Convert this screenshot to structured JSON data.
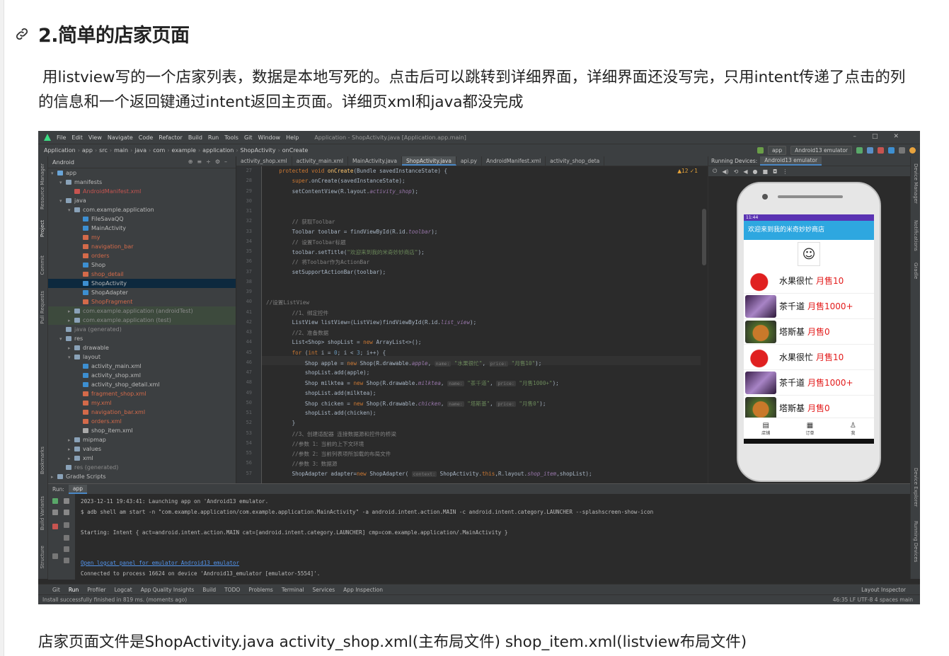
{
  "heading": "2.简单的店家页面",
  "paragraph": "用listview写的一个店家列表，数据是本地写死的。点击后可以跳转到详细界面，详细界面还没写完，只用intent传递了点击的列的信息和一个返回键通过intent返回主页面。详细页xml和java都没完成",
  "footer_text": "店家页面文件是ShopActivity.java activity_shop.xml(主布局文件) shop_item.xml(listview布局文件)",
  "ide": {
    "menu": [
      "File",
      "Edit",
      "View",
      "Navigate",
      "Code",
      "Refactor",
      "Build",
      "Run",
      "Tools",
      "Git",
      "Window",
      "Help"
    ],
    "window_title": "Application - ShopActivity.java [Application.app.main]",
    "breadcrumbs": [
      "Application",
      "app",
      "src",
      "main",
      "java",
      "com",
      "example",
      "application",
      "ShopActivity",
      "onCreate"
    ],
    "run_config": "app",
    "device_selector": "Android13 emulator",
    "project_view": "Android",
    "tree": [
      {
        "label": "app",
        "indent": 0,
        "arrow": "▾",
        "color": "#6aa5d8"
      },
      {
        "label": "manifests",
        "indent": 1,
        "arrow": "▾",
        "color": "#8aa2b8"
      },
      {
        "label": "AndroidManifest.xml",
        "indent": 2,
        "arrow": "",
        "color": "#c75450"
      },
      {
        "label": "java",
        "indent": 1,
        "arrow": "▾",
        "color": "#8aa2b8"
      },
      {
        "label": "com.example.application",
        "indent": 2,
        "arrow": "▾",
        "color": "#8aa2b8"
      },
      {
        "label": "FileSavaQQ",
        "indent": 3,
        "arrow": "",
        "color": "#3d8fd1"
      },
      {
        "label": "MainActivity",
        "indent": 3,
        "arrow": "",
        "color": "#3d8fd1"
      },
      {
        "label": "my",
        "indent": 3,
        "arrow": "",
        "color": "#d46a4a"
      },
      {
        "label": "navigation_bar",
        "indent": 3,
        "arrow": "",
        "color": "#d46a4a"
      },
      {
        "label": "orders",
        "indent": 3,
        "arrow": "",
        "color": "#d46a4a"
      },
      {
        "label": "Shop",
        "indent": 3,
        "arrow": "",
        "color": "#3d8fd1"
      },
      {
        "label": "shop_detail",
        "indent": 3,
        "arrow": "",
        "color": "#d46a4a"
      },
      {
        "label": "ShopActivity",
        "indent": 3,
        "arrow": "",
        "color": "#3d8fd1"
      },
      {
        "label": "ShopAdapter",
        "indent": 3,
        "arrow": "",
        "color": "#3d8fd1"
      },
      {
        "label": "ShopFragment",
        "indent": 3,
        "arrow": "",
        "color": "#d46a4a"
      },
      {
        "label": "com.example.application (androidTest)",
        "indent": 2,
        "arrow": "▸",
        "color": "#8aa2b8"
      },
      {
        "label": "com.example.application (test)",
        "indent": 2,
        "arrow": "▸",
        "color": "#8aa2b8"
      },
      {
        "label": "java (generated)",
        "indent": 1,
        "arrow": "",
        "color": "#8aa2b8"
      },
      {
        "label": "res",
        "indent": 1,
        "arrow": "▾",
        "color": "#8aa2b8"
      },
      {
        "label": "drawable",
        "indent": 2,
        "arrow": "▸",
        "color": "#8aa2b8"
      },
      {
        "label": "layout",
        "indent": 2,
        "arrow": "▾",
        "color": "#8aa2b8"
      },
      {
        "label": "activity_main.xml",
        "indent": 3,
        "arrow": "",
        "color": "#3d8fd1"
      },
      {
        "label": "activity_shop.xml",
        "indent": 3,
        "arrow": "",
        "color": "#3d8fd1"
      },
      {
        "label": "activity_shop_detail.xml",
        "indent": 3,
        "arrow": "",
        "color": "#3d8fd1"
      },
      {
        "label": "fragment_shop.xml",
        "indent": 3,
        "arrow": "",
        "color": "#d46a4a"
      },
      {
        "label": "my.xml",
        "indent": 3,
        "arrow": "",
        "color": "#d46a4a"
      },
      {
        "label": "navigation_bar.xml",
        "indent": 3,
        "arrow": "",
        "color": "#d46a4a"
      },
      {
        "label": "orders.xml",
        "indent": 3,
        "arrow": "",
        "color": "#d46a4a"
      },
      {
        "label": "shop_item.xml",
        "indent": 3,
        "arrow": "",
        "color": "#aaaaaa"
      },
      {
        "label": "mipmap",
        "indent": 2,
        "arrow": "▸",
        "color": "#8aa2b8"
      },
      {
        "label": "values",
        "indent": 2,
        "arrow": "▸",
        "color": "#8aa2b8"
      },
      {
        "label": "xml",
        "indent": 2,
        "arrow": "▸",
        "color": "#8aa2b8"
      },
      {
        "label": "res (generated)",
        "indent": 1,
        "arrow": "",
        "color": "#8aa2b8"
      },
      {
        "label": "Gradle Scripts",
        "indent": 0,
        "arrow": "▸",
        "color": "#8aa2b8"
      }
    ],
    "tabs": [
      "activity_shop.xml",
      "activity_main.xml",
      "MainActivity.java",
      "ShopActivity.java",
      "api.py",
      "AndroidManifest.xml",
      "activity_shop_deta"
    ],
    "active_tab": "ShopActivity.java",
    "inspection": "▲12 ✓1",
    "code_lines": [
      {
        "n": "27",
        "h": "    <span class='kw'>protected void </span><span class='fn'>onCreate</span>(Bundle savedInstanceState) {"
      },
      {
        "n": "28",
        "h": "        <span class='kw'>super</span>.onCreate(savedInstanceState);"
      },
      {
        "n": "29",
        "h": "        setContentView(R.layout.<span class='it'>activity_shop</span>);"
      },
      {
        "n": "30",
        "h": ""
      },
      {
        "n": "31",
        "h": ""
      },
      {
        "n": "32",
        "h": "        <span class='cm'>// 获取Toolbar</span>"
      },
      {
        "n": "33",
        "h": "        Toolbar toolbar = findViewById(R.id.<span class='it'>toolbar</span>);"
      },
      {
        "n": "34",
        "h": "        <span class='cm'>// 设置Toolbar标题</span>"
      },
      {
        "n": "35",
        "h": "        toolbar.setTitle(<span class='str'>\"欢迎来到我的米奇妙妙商店\"</span>);"
      },
      {
        "n": "36",
        "h": "        <span class='cm'>// 将Toolbar作为ActionBar</span>"
      },
      {
        "n": "37",
        "h": "        setSupportActionBar(toolbar);"
      },
      {
        "n": "38",
        "h": ""
      },
      {
        "n": "39",
        "h": ""
      },
      {
        "n": "40",
        "h": "<span class='cm'>//设置ListView</span>"
      },
      {
        "n": "41",
        "h": "        <span class='cm'>//1、绑定控件</span>"
      },
      {
        "n": "42",
        "h": "        ListView listView=(ListView)findViewById(R.id.<span class='it'>list_view</span>);"
      },
      {
        "n": "43",
        "h": "        <span class='cm'>//2、准备数据</span>"
      },
      {
        "n": "44",
        "h": "        List&lt;Shop&gt; shopList = <span class='kw'>new </span>ArrayList&lt;&gt;();"
      },
      {
        "n": "45",
        "h": "        <span class='kw'>for </span>(<span class='kw'>int </span>i = <span style='color:#6897bb'>0</span>; i &lt; <span style='color:#6897bb'>3</span>; i++) {"
      },
      {
        "n": "46",
        "h": "            Shop apple = <span class='kw'>new </span>Shop(R.drawable.<span class='it'>apple</span>, <span class='hint'>name:</span> <span class='str'>\"水果很忙\"</span>, <span class='hint'>price:</span> <span class='str'>\"月售10\"</span>);"
      },
      {
        "n": "47",
        "h": "            shopList.add(apple);"
      },
      {
        "n": "48",
        "h": "            Shop milktea = <span class='kw'>new </span>Shop(R.drawable.<span class='it'>milktea</span>, <span class='hint'>name:</span> <span class='str'>\"茶千道\"</span>, <span class='hint'>price:</span> <span class='str'>\"月售1000+\"</span>);"
      },
      {
        "n": "49",
        "h": "            shopList.add(milktea);"
      },
      {
        "n": "50",
        "h": "            Shop chicken = <span class='kw'>new </span>Shop(R.drawable.<span class='it'>chicken</span>, <span class='hint'>name:</span> <span class='str'>\"塔斯基\"</span>, <span class='hint'>price:</span> <span class='str'>\"月售0\"</span>);"
      },
      {
        "n": "51",
        "h": "            shopList.add(chicken);"
      },
      {
        "n": "52",
        "h": "        }"
      },
      {
        "n": "53",
        "h": "        <span class='cm'>//3、创建适配器 连接数据源和控件的桥梁</span>"
      },
      {
        "n": "54",
        "h": "        <span class='cm'>//参数 1：当前的上下文环境</span>"
      },
      {
        "n": "55",
        "h": "        <span class='cm'>//参数 2：当前列表项所加载的布局文件</span>"
      },
      {
        "n": "56",
        "h": "        <span class='cm'>//参数 3：数据源</span>"
      },
      {
        "n": "57",
        "h": "        ShopAdapter adapter=<span class='kw'>new </span>ShopAdapter( <span class='hint'>context:</span> ShopActivity.<span class='kw'>this</span>,R.layout.<span class='it'>shop_item</span>,shopList);"
      }
    ],
    "running_devices_label": "Running Devices:",
    "emulator_tab": "Android13 emulator",
    "phone": {
      "status_time": "11:44",
      "toolbar_title": "欢迎来到我的米奇妙妙商店",
      "shops": [
        {
          "name": "水果很忙",
          "sold": "月售10",
          "img": "apple"
        },
        {
          "name": "茶千道",
          "sold": "月售1000+",
          "img": "milk"
        },
        {
          "name": "塔斯基",
          "sold": "月售0",
          "img": "chicken"
        },
        {
          "name": "水果很忙",
          "sold": "月售10",
          "img": "apple"
        },
        {
          "name": "茶千道",
          "sold": "月售1000+",
          "img": "milk"
        },
        {
          "name": "塔斯基",
          "sold": "月售0",
          "img": "chicken"
        }
      ],
      "nav": [
        "店铺",
        "订单",
        "我"
      ]
    },
    "run_label": "Run:",
    "run_tab": "app",
    "output": [
      {
        "t": "2023-12-11 19:43:41: Launching app on 'Android13 emulator.",
        "link": false
      },
      {
        "t": "$ adb shell am start -n \"com.example.application/com.example.application.MainActivity\" -a android.intent.action.MAIN -c android.intent.category.LAUNCHER --splashscreen-show-icon",
        "link": false
      },
      {
        "t": "",
        "link": false
      },
      {
        "t": "Starting: Intent { act=android.intent.action.MAIN cat=[android.intent.category.LAUNCHER] cmp=com.example.application/.MainActivity }",
        "link": false
      },
      {
        "t": "",
        "link": false
      },
      {
        "t": "",
        "link": false
      },
      {
        "t": "Open logcat panel for emulator Android13 emulator",
        "link": true
      },
      {
        "t": "Connected to process 16624 on device 'Android13_emulator [emulator-5554]'.",
        "link": false
      }
    ],
    "bottom_tools": [
      "Git",
      "Run",
      "Profiler",
      "Logcat",
      "App Quality Insights",
      "Build",
      "TODO",
      "Problems",
      "Terminal",
      "Services",
      "App Inspection"
    ],
    "layout_inspector": "Layout Inspector",
    "status_message": "Install successfully finished in 819 ms. (moments ago)",
    "status_right": "46:35   LF   UTF-8   4 spaces   main"
  }
}
